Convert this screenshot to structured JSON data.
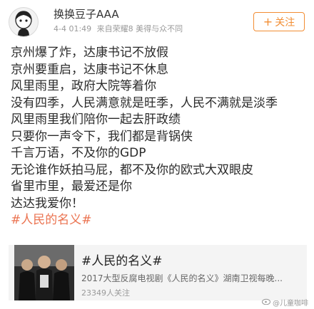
{
  "post": {
    "username": "换换豆子AAA",
    "time": "4-4 01:49",
    "source": "来自荣耀8 美得与众不同",
    "follow_label": "关注",
    "follow_icon": "plus-icon",
    "accent_color": "#f28d33"
  },
  "content": {
    "lines": [
      "京州爆了炸，达康书记不放假",
      "京州要重启，达康书记不休息",
      "风里雨里，政府大院等着你",
      "没有四季，人民满意就是旺季，人民不满就是淡季",
      "风里雨里我们陪你一起去肝政绩",
      "只要你一声令下，我们都是背锅侠",
      "千言万语，不及你的GDP",
      "无论谁作妖拍马屁，都不及你的欧式大双眼皮",
      "省里市里，最爱还是你",
      "达达我爱你！"
    ],
    "topic": "#人民的名义#",
    "topic_color": "#eb7350"
  },
  "card": {
    "title": "#人民的名义#",
    "description": "2017大型反腐电视剧《人民的名义》湖南卫视每晚...",
    "followers": "23349人关注"
  },
  "watermark": {
    "text": "@儿童咖啡"
  }
}
